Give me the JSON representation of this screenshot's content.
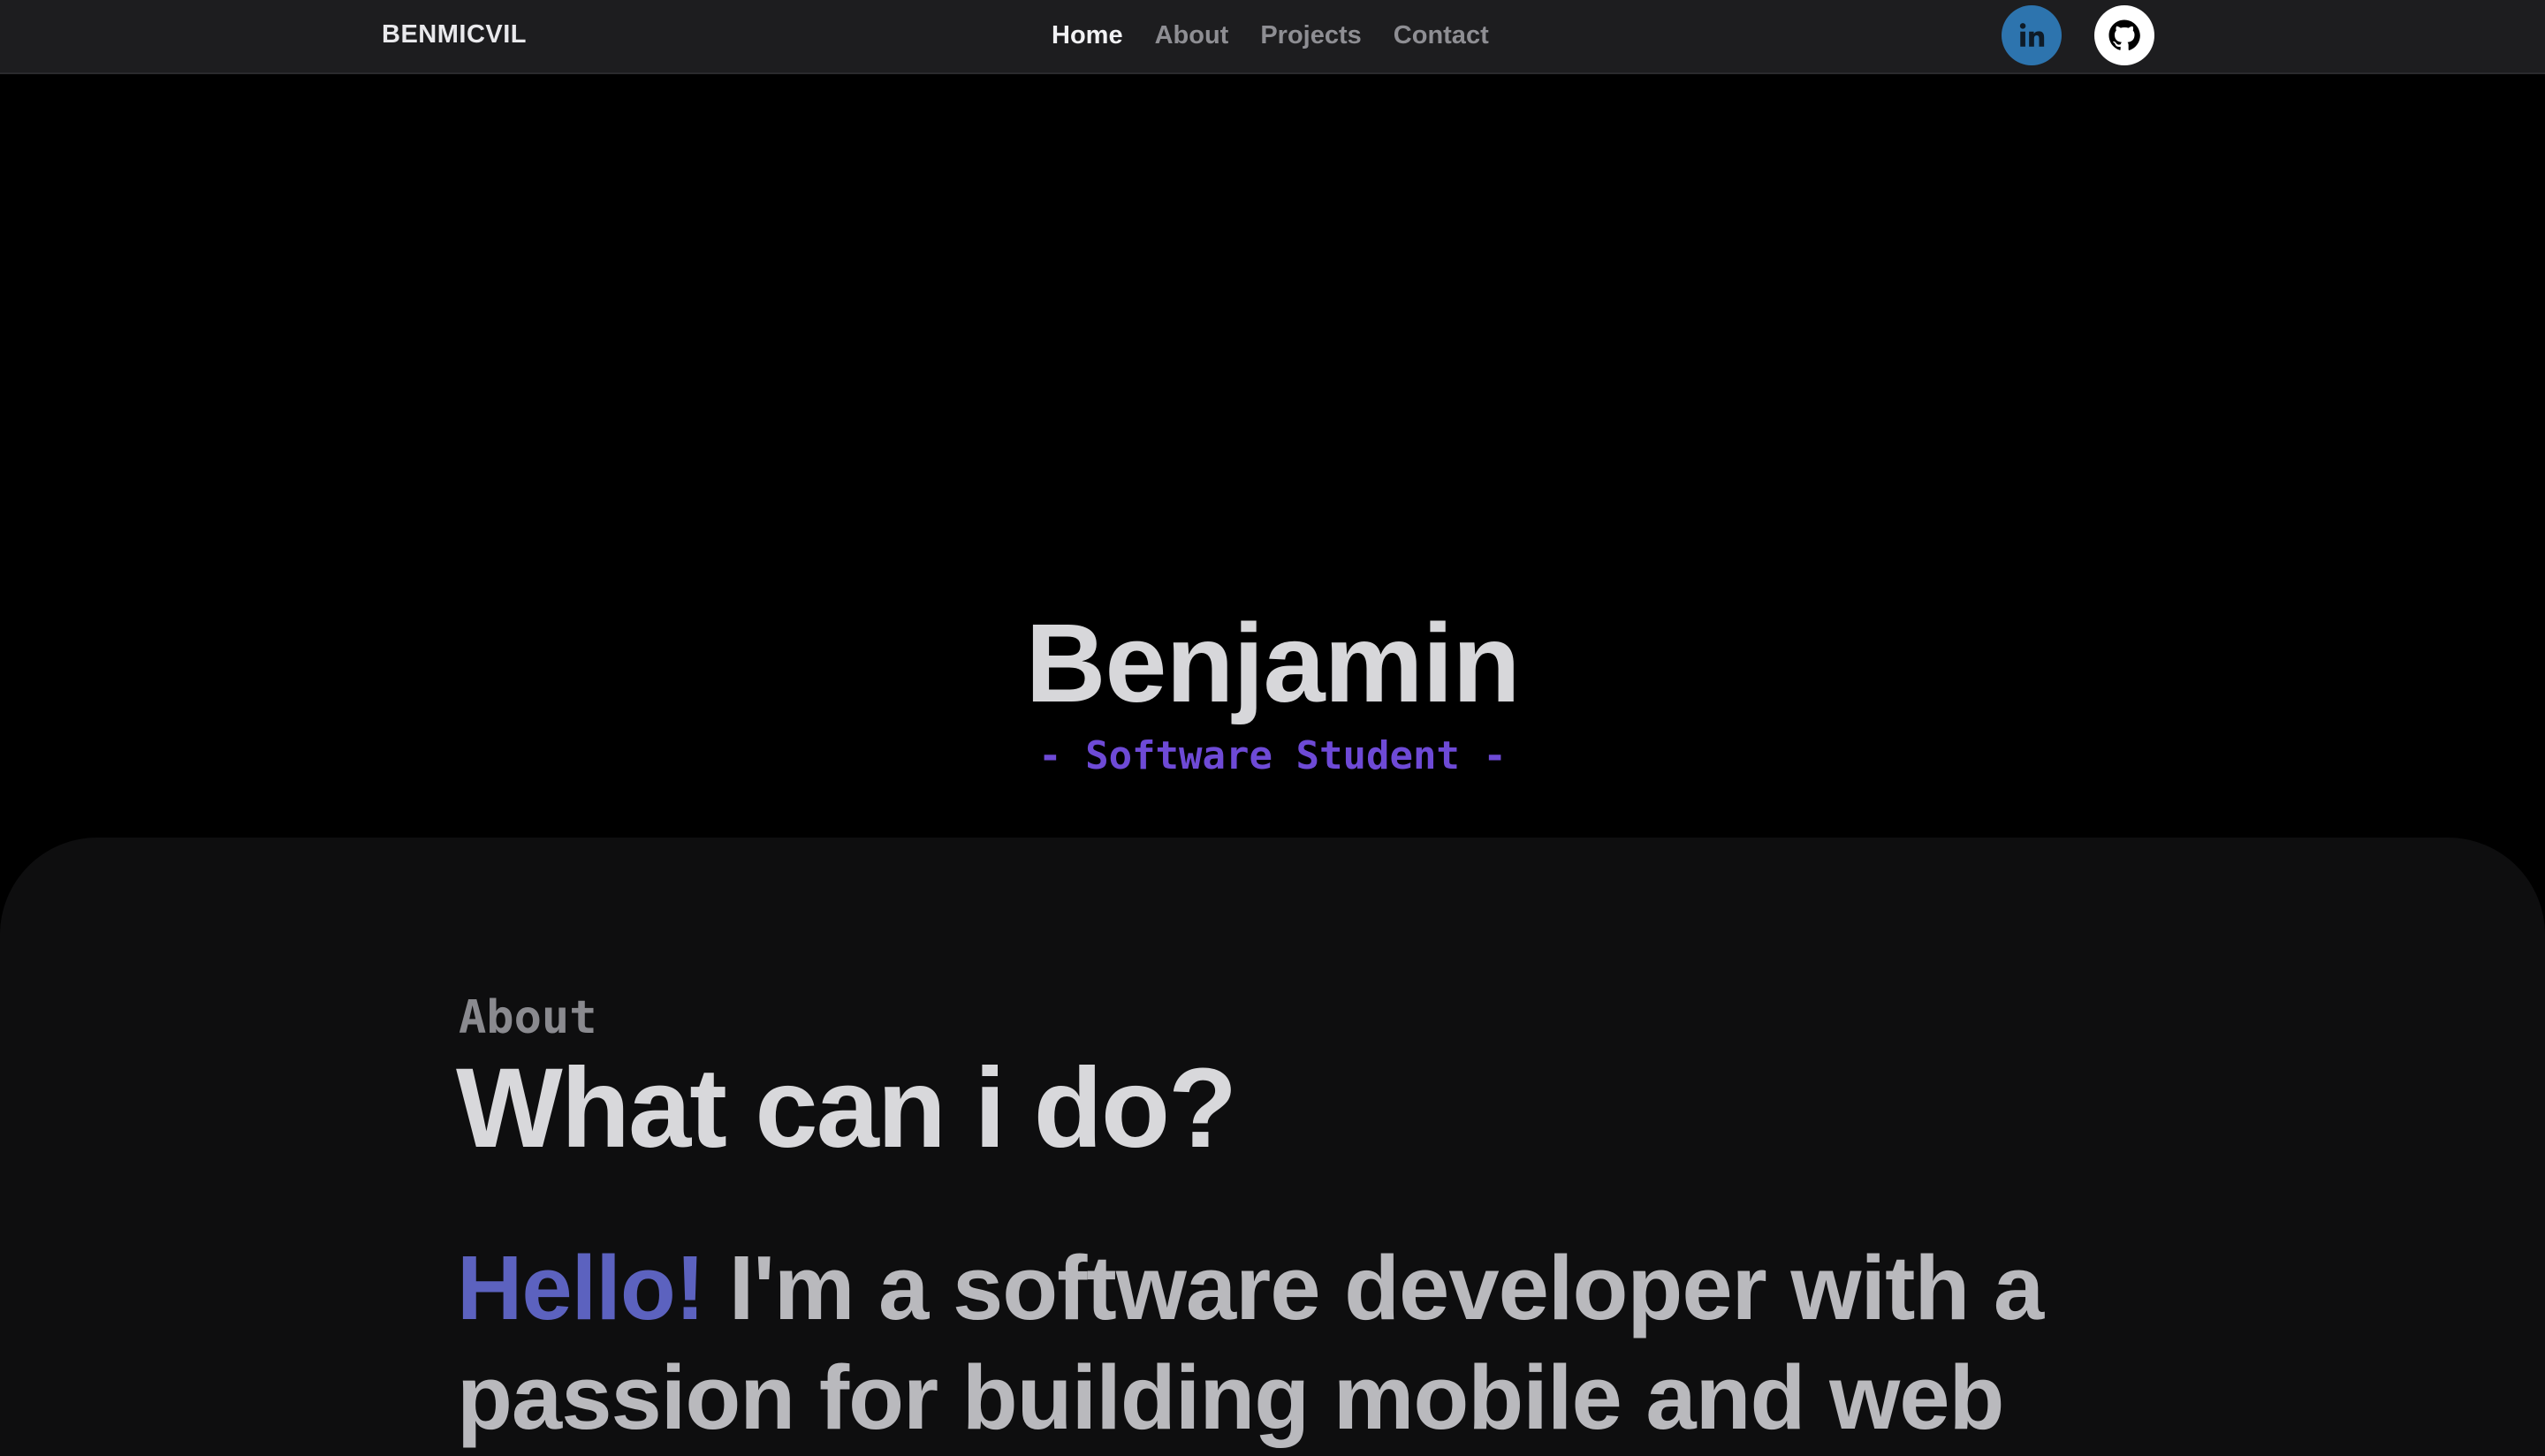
{
  "navbar": {
    "brand": "BENMICVIL",
    "links": [
      {
        "label": "Home",
        "active": true
      },
      {
        "label": "About",
        "active": false
      },
      {
        "label": "Projects",
        "active": false
      },
      {
        "label": "Contact",
        "active": false
      }
    ],
    "social": [
      {
        "name": "linkedin",
        "icon": "linkedin-icon",
        "color": "#2d74ae"
      },
      {
        "name": "github",
        "icon": "github-icon",
        "color": "#ffffff"
      }
    ]
  },
  "hero": {
    "name": "Benjamin",
    "tagline": "- Software Student -",
    "tagline_color": "#6e4ad6"
  },
  "about": {
    "eyebrow": "About",
    "heading": "What can i do?",
    "greeting": "Hello!",
    "text": " I'm a software developer with a passion for building mobile and web",
    "greeting_color": "#5c62bf"
  }
}
